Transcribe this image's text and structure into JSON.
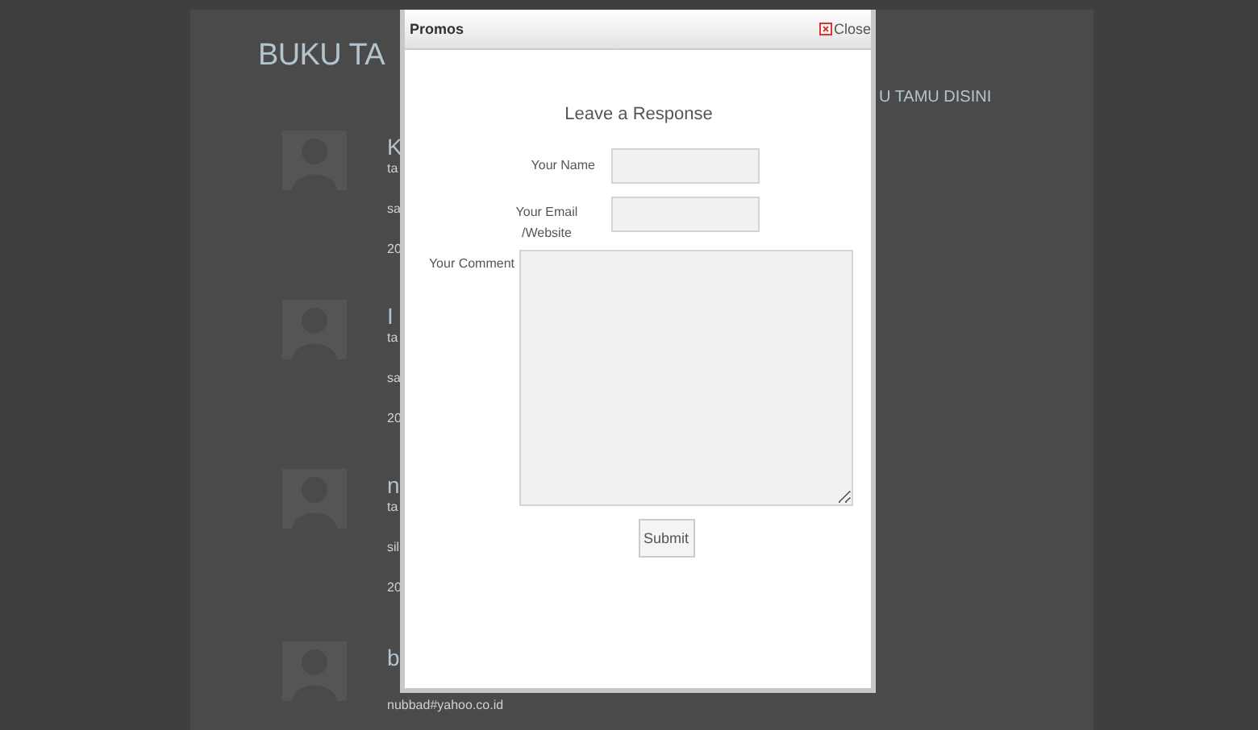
{
  "page": {
    "title": "BUKU TA",
    "link": "U TAMU DISINI",
    "entries": [
      {
        "name": "K",
        "lines": [
          "ta",
          "sa",
          "20"
        ]
      },
      {
        "name": "I",
        "lines": [
          "ta",
          "sa",
          "20"
        ]
      },
      {
        "name": "n",
        "lines": [
          "ta",
          "sil",
          "20"
        ]
      },
      {
        "name": "b",
        "lines": [
          "nubbad#yahoo.co.id"
        ]
      }
    ]
  },
  "dialog": {
    "title": "Promos",
    "close": "Close",
    "heading": "Leave a Response",
    "fields": [
      {
        "kind": "input",
        "label": "Your Name"
      },
      {
        "kind": "input",
        "label": "Your Email /Website"
      },
      {
        "kind": "textarea",
        "label": "Your Comment"
      }
    ],
    "submit": "Submit"
  }
}
